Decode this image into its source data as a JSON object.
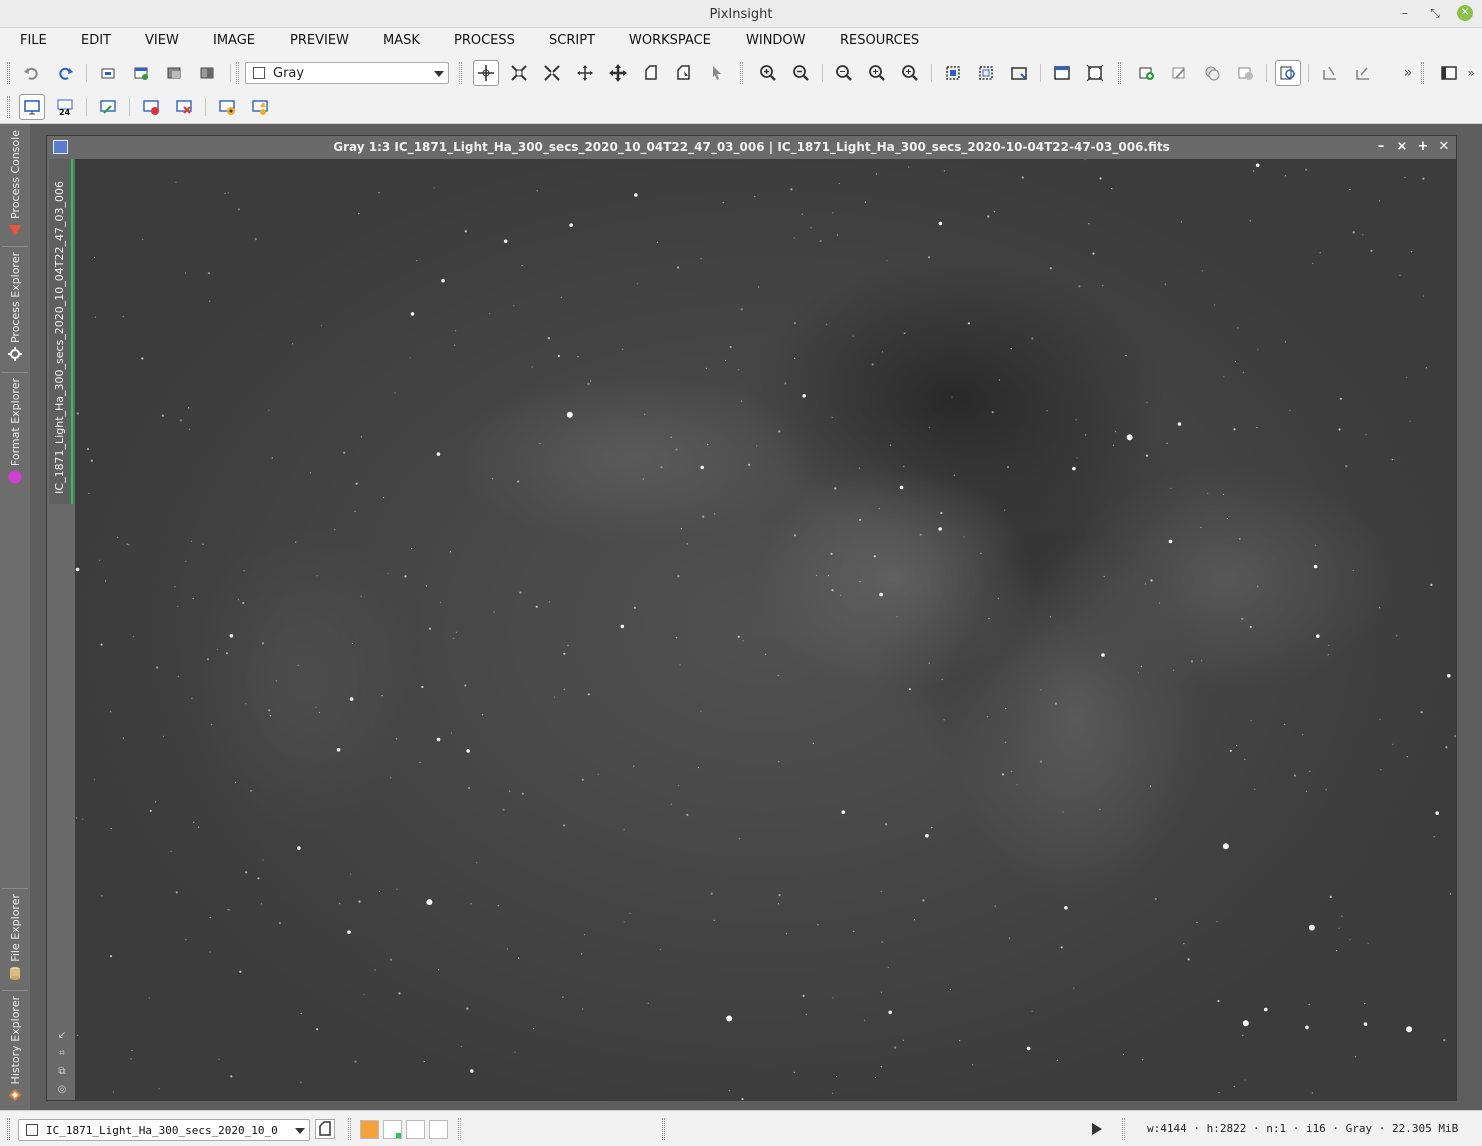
{
  "app": {
    "title": "PixInsight"
  },
  "menu": [
    "FILE",
    "EDIT",
    "VIEW",
    "IMAGE",
    "PREVIEW",
    "MASK",
    "PROCESS",
    "SCRIPT",
    "WORKSPACE",
    "WINDOW",
    "RESOURCES"
  ],
  "toolbar": {
    "colorspace_select": "Gray",
    "overflow": "»"
  },
  "left_dock": {
    "tabs": [
      "Process Console",
      "Process Explorer",
      "Format Explorer",
      "File Explorer",
      "History Explorer"
    ]
  },
  "image_window": {
    "title": "Gray 1:3 IC_1871_Light_Ha_300_secs_2020_10_04T22_47_03_006 | IC_1871_Light_Ha_300_secs_2020-10-04T22-47-03_006.fits",
    "view_id": "IC_1871_Light_Ha_300_secs_2020_10_04T22_47_03_006"
  },
  "status": {
    "view_select": "IC_1871_Light_Ha_300_secs_2020_10_0",
    "info": "w:4144 · h:2822 · n:1 · i16 · Gray · 22.305 MiB"
  },
  "colors": {
    "accent_green": "#25c95a",
    "mask_swatch": "#f4a23c",
    "dock_bg": "#6d6d6d",
    "window_close": "#8bc34a"
  }
}
